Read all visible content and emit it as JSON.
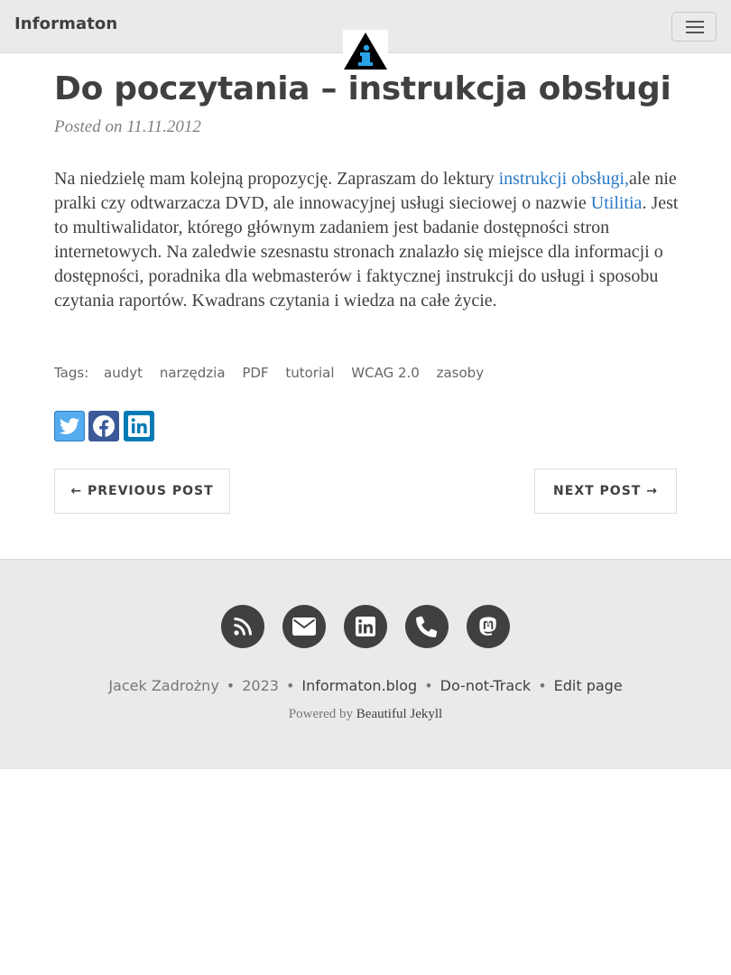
{
  "navbar": {
    "brand": "Informaton",
    "menu_icon": "hamburger-menu-icon",
    "logo_icon": "info-triangle-logo"
  },
  "post": {
    "title": "Do poczytania – instrukcja obsługi",
    "meta": "Posted on 11.11.2012",
    "body": {
      "part1": "Na niedzielę mam kolejną propozycję. Zapraszam do lektury ",
      "link1": "instrukcji obsługi,",
      "part2": "ale nie pralki czy odtwarzacza DVD, ale innowacyjnej usługi sieciowej o nazwie ",
      "link2": "Utilitia",
      "part3": ". Jest to multiwalidator, którego głównym zadaniem jest badanie dostępności stron internetowych. Na zaledwie szesnastu stronach znalazło się miejsce dla informacji o dostępności, poradnika dla webmasterów i faktycznej instrukcji do usługi i sposobu czytania raportów. Kwadrans czytania i wiedza na całe życie."
    },
    "tags_label": "Tags:",
    "tags": [
      "audyt",
      "narzędzia",
      "PDF",
      "tutorial",
      "WCAG 2.0",
      "zasoby"
    ],
    "share": [
      {
        "icon": "twitter-icon",
        "color": "#55acee"
      },
      {
        "icon": "facebook-icon",
        "color": "#3b5998"
      },
      {
        "icon": "linkedin-icon",
        "color": "#007bb5"
      }
    ],
    "pager": {
      "previous": "← PREVIOUS POST",
      "next": "NEXT POST →"
    }
  },
  "footer": {
    "social_icons": [
      "rss-icon",
      "envelope-icon",
      "linkedin-icon",
      "phone-icon",
      "mastodon-icon"
    ],
    "author": "Jacek Zadrożny",
    "year": "2023",
    "site": "Informaton.blog",
    "dnt": "Do-not-Track",
    "edit": "Edit page",
    "separator": "•",
    "powered_prefix": "Powered by ",
    "powered_link": "Beautiful Jekyll"
  },
  "colors": {
    "link": "#2a7ac7",
    "navbar_bg": "#eaeaea",
    "footer_bg": "#eaeaea",
    "text": "#404040"
  }
}
